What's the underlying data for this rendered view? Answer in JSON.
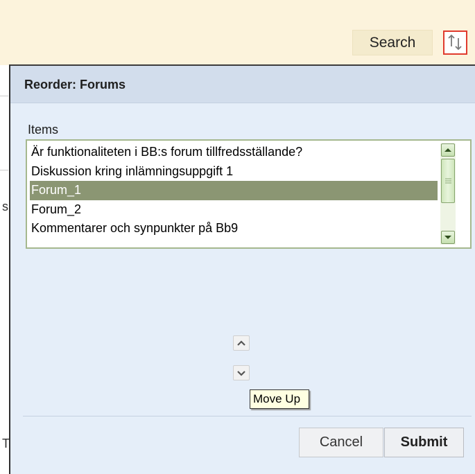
{
  "page": {
    "search_label": "Search",
    "side_fragment_1": "s",
    "side_fragment_2": "T"
  },
  "dialog": {
    "title": "Reorder: Forums",
    "items_label": "Items",
    "items": [
      {
        "label": "Är funktionaliteten i BB:s forum tillfredsställande?",
        "selected": false
      },
      {
        "label": "Diskussion kring inlämningsuppgift 1",
        "selected": false
      },
      {
        "label": "Forum_1",
        "selected": true
      },
      {
        "label": "Forum_2",
        "selected": false
      },
      {
        "label": "Kommentarer och synpunkter på Bb9",
        "selected": false
      }
    ],
    "tooltip": "Move Up",
    "cancel_label": "Cancel",
    "submit_label": "Submit"
  },
  "colors": {
    "topbar": "#fcf3dc",
    "dialog_bg": "#e5eef9",
    "header_bg": "#d2ddec",
    "selected_row": "#8b9673",
    "focus_outline": "#e03a2d"
  },
  "icons": {
    "reorder_toggle": "up-down-arrows-icon",
    "scroll_up": "scroll-up-arrow-icon",
    "scroll_down": "scroll-down-arrow-icon",
    "move_up": "chevron-up-icon",
    "move_down": "chevron-down-icon"
  }
}
